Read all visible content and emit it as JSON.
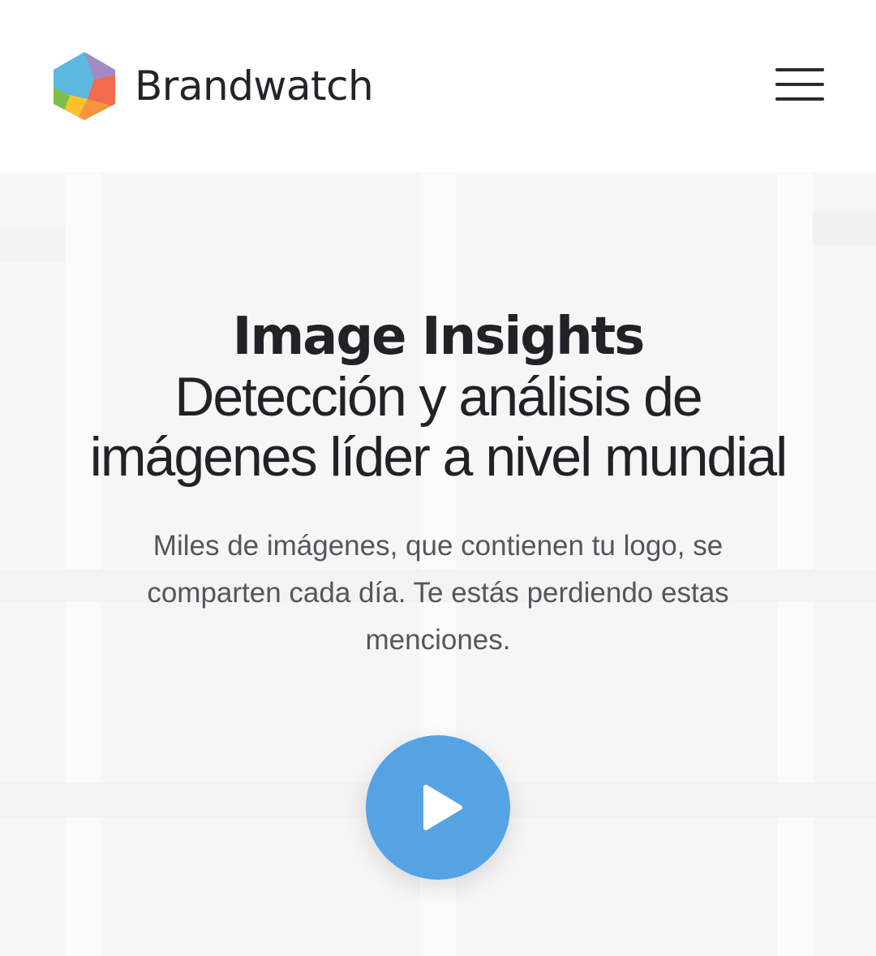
{
  "header": {
    "brand_name": "Brandwatch",
    "logo_icon": "hexagon-logo-icon",
    "menu_icon": "hamburger-menu-icon"
  },
  "hero": {
    "title": "Image Insights",
    "subtitle_line1": "Detección y análisis de",
    "subtitle_line2": "imágenes líder a nivel mundial",
    "lead": "Miles de imágenes, que contienen tu logo, se comparten cada día. Te estás perdiendo estas menciones.",
    "play_icon": "play-icon"
  },
  "colors": {
    "text_dark": "#222226",
    "text_muted": "#55555c",
    "accent_blue": "#55a3e3",
    "hero_bg": "#f6f6f7"
  }
}
